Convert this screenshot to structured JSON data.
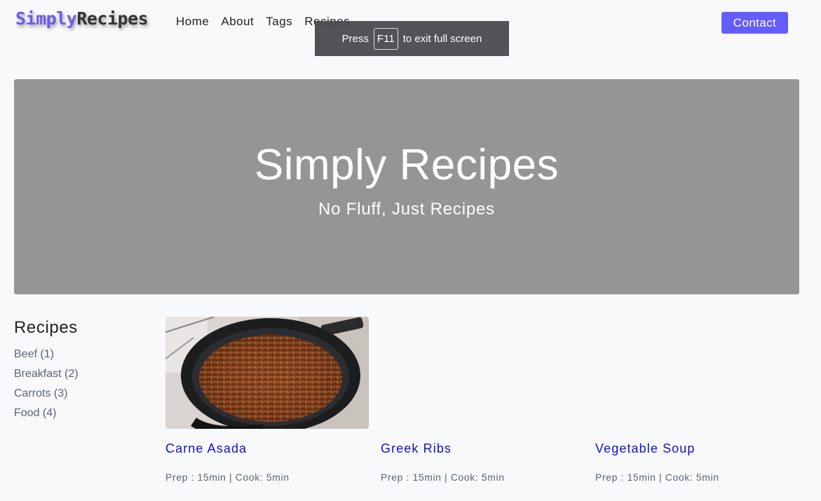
{
  "logo": {
    "part1": "Simply",
    "part2": "Recipes"
  },
  "nav": {
    "items": [
      {
        "label": "Home"
      },
      {
        "label": "About"
      },
      {
        "label": "Tags"
      },
      {
        "label": "Recipes"
      }
    ],
    "contact_label": "Contact"
  },
  "fullscreen_notice": {
    "prefix": "Press",
    "key": "F11",
    "suffix": "to exit full screen"
  },
  "hero": {
    "title": "Simply Recipes",
    "subtitle": "No Fluff, Just Recipes"
  },
  "sidebar": {
    "heading": "Recipes",
    "tags": [
      {
        "label": "Beef (1)"
      },
      {
        "label": "Breakfast (2)"
      },
      {
        "label": "Carrots (3)"
      },
      {
        "label": "Food (4)"
      }
    ]
  },
  "recipes": [
    {
      "title": "Carne Asada",
      "meta": "Prep : 15min | Cook: 5min",
      "image": "skillet-meat-photo"
    },
    {
      "title": "Greek Ribs",
      "meta": "Prep : 15min | Cook: 5min",
      "image": ""
    },
    {
      "title": "Vegetable Soup",
      "meta": "Prep : 15min | Cook: 5min",
      "image": ""
    }
  ],
  "colors": {
    "accent": "#645cff",
    "logo_accent": "#6c5ce7",
    "hero_bg": "#949597",
    "recipe_link": "#1212c9",
    "page_bg": "#f8f9fb"
  }
}
